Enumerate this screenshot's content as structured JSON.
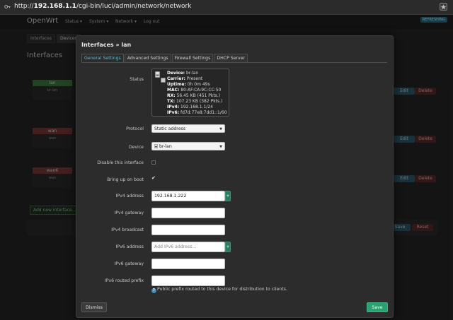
{
  "browser": {
    "url_prefix": "http://",
    "url_host": "192.168.1.1",
    "url_path": "/cgi-bin/luci/admin/network/network"
  },
  "background": {
    "brand": "OpenWrt",
    "menu": [
      "Status ▾",
      "System ▾",
      "Network ▾",
      "Log out"
    ],
    "refresh_badge": "REFRESHING",
    "subtabs": [
      "Interfaces",
      "Devices"
    ],
    "section_title": "Interfaces",
    "interfaces": [
      {
        "name": "lan",
        "device": "br-lan"
      },
      {
        "name": "wan",
        "device": "wan"
      },
      {
        "name": "wan6",
        "device": "wan"
      }
    ],
    "edit_label": "Edit",
    "delete_label": "Delete",
    "add_label": "Add new interface...",
    "save_label": "Save",
    "reset_label": "Reset"
  },
  "modal": {
    "title": "Interfaces » lan",
    "tabs": [
      "General Settings",
      "Advanced Settings",
      "Firewall Settings",
      "DHCP Server"
    ],
    "active_tab": 0,
    "labels": {
      "status": "Status",
      "protocol": "Protocol",
      "device": "Device",
      "disable": "Disable this interface",
      "boot": "Bring up on boot",
      "ipv4_address": "IPv4 address",
      "ipv4_gateway": "IPv4 gateway",
      "ipv4_broadcast": "IPv4 broadcast",
      "ipv6_address": "IPv6 address",
      "ipv6_gateway": "IPv6 gateway",
      "ipv6_prefix": "IPv6 routed prefix"
    },
    "status": [
      {
        "key": "Device:",
        "value": " br-lan"
      },
      {
        "key": "Carrier:",
        "value": " Present"
      },
      {
        "key": "Uptime:",
        "value": " 0h 0m 49s"
      },
      {
        "key": "MAC:",
        "value": " 80:AF:CA:9C:CC:50"
      },
      {
        "key": "RX:",
        "value": " 56.45 KB (451 Pkts.)"
      },
      {
        "key": "TX:",
        "value": " 107.23 KB (382 Pkts.)"
      },
      {
        "key": "IPv4:",
        "value": " 192.168.1.1/24"
      },
      {
        "key": "IPv6:",
        "value": " fd7d:77e8:7dd1::1/60"
      }
    ],
    "protocol_value": "Static address",
    "device_value": "br-lan",
    "disable_checked": false,
    "boot_checked": true,
    "ipv4_address_value": "192.168.1.222",
    "ipv4_gateway_value": "",
    "ipv4_broadcast_value": "",
    "ipv6_address_placeholder": "Add IPv6 address...",
    "ipv6_gateway_value": "",
    "ipv6_prefix_value": "",
    "plus_label": "+",
    "hint": "Public prefix routed to this device for distribution to clients.",
    "dismiss_label": "Dismiss",
    "save_label": "Save"
  },
  "colors": {
    "accent": "#6ab7d6",
    "save": "#2aa171",
    "delete": "#5a2a2a"
  }
}
